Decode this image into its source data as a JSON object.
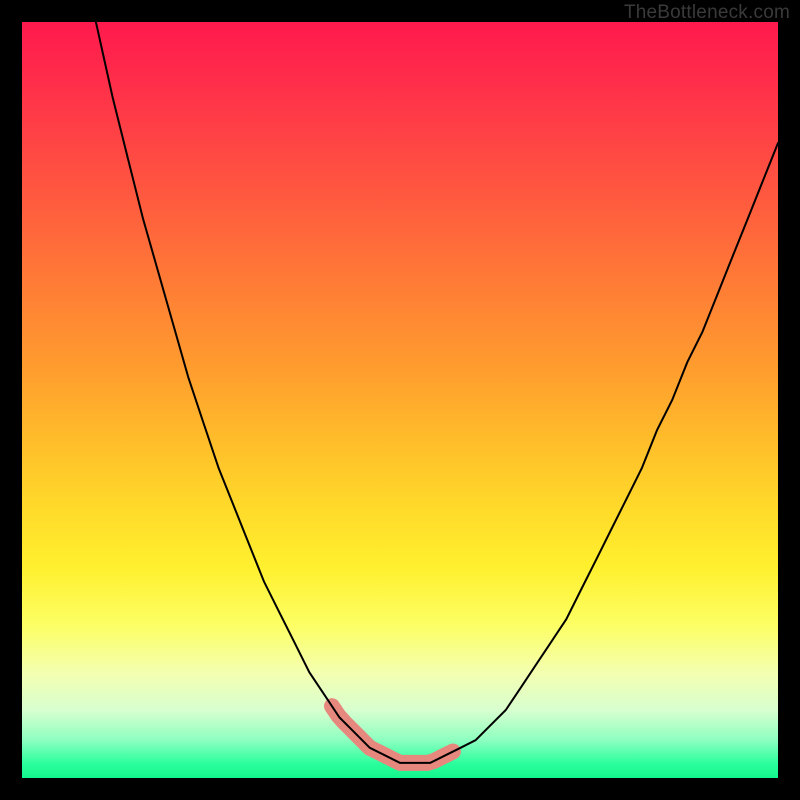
{
  "watermark": "TheBottleneck.com",
  "colors": {
    "frame": "#000000",
    "curve_stroke": "#000000",
    "trough_fill": "#e6887e",
    "trough_stroke": "#e6887e",
    "gradient_top": "#ff1a4d",
    "gradient_bottom": "#12f68c"
  },
  "chart_data": {
    "type": "line",
    "title": "",
    "xlabel": "",
    "ylabel": "",
    "xlim": [
      0,
      100
    ],
    "ylim": [
      0,
      100
    ],
    "grid": false,
    "legend": false,
    "x": [
      0,
      2,
      4,
      6,
      8,
      10,
      12,
      14,
      16,
      18,
      20,
      22,
      24,
      26,
      28,
      30,
      32,
      34,
      36,
      38,
      40,
      42,
      44,
      46,
      48,
      50,
      52,
      54,
      56,
      58,
      60,
      62,
      64,
      66,
      68,
      70,
      72,
      74,
      76,
      78,
      80,
      82,
      84,
      86,
      88,
      90,
      92,
      94,
      96,
      98,
      100
    ],
    "series": [
      {
        "name": "curve",
        "values": [
          148,
          138,
          128,
          118,
          108,
          99,
          90,
          82,
          74,
          67,
          60,
          53,
          47,
          41,
          36,
          31,
          26,
          22,
          18,
          14,
          11,
          8,
          6,
          4,
          3,
          2,
          2,
          2,
          3,
          4,
          5,
          7,
          9,
          12,
          15,
          18,
          21,
          25,
          29,
          33,
          37,
          41,
          46,
          50,
          55,
          59,
          64,
          69,
          74,
          79,
          84
        ]
      }
    ],
    "annotations": [
      {
        "type": "highlight_range",
        "x_start": 41,
        "x_end": 57,
        "note": "rounded trough marker near minimum"
      }
    ]
  }
}
